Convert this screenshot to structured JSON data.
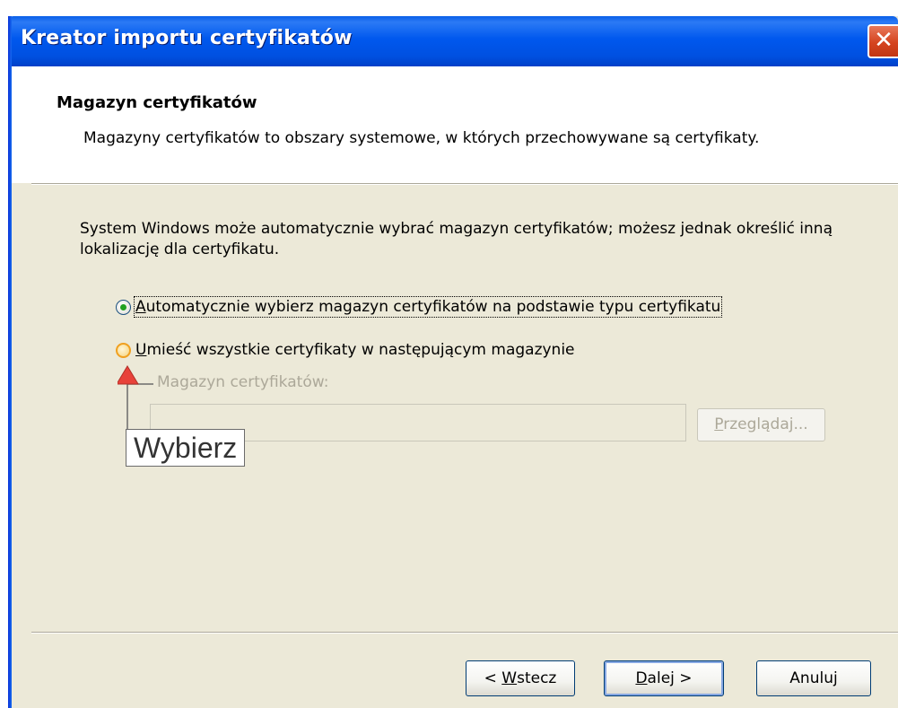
{
  "window": {
    "title": "Kreator importu certyfikatów",
    "close_glyph": "✕"
  },
  "header": {
    "title": "Magazyn certyfikatów",
    "subtitle": "Magazyny certyfikatów to obszary systemowe, w których przechowywane są certyfikaty."
  },
  "body": {
    "description": "System Windows może automatycznie wybrać magazyn certyfikatów; możesz jednak określić inną lokalizację dla certyfikatu."
  },
  "options": {
    "auto": {
      "accel": "A",
      "rest": "utomatycznie wybierz magazyn certyfikatów na podstawie typu certyfikatu",
      "selected": true
    },
    "manual": {
      "accel": "U",
      "rest": "mieść wszystkie certyfikaty w następującym magazynie",
      "selected": false
    }
  },
  "store": {
    "label": "Magazyn certyfikatów:",
    "value": "",
    "browse_accel": "P",
    "browse_rest": "rzeglądaj..."
  },
  "annotation": {
    "text": "Wybierz",
    "arrow_color": "#e8423a"
  },
  "buttons": {
    "back_prefix": "< ",
    "back_accel": "W",
    "back_rest": "stecz",
    "next_accel": "D",
    "next_rest": "alej >",
    "cancel": "Anuluj"
  }
}
